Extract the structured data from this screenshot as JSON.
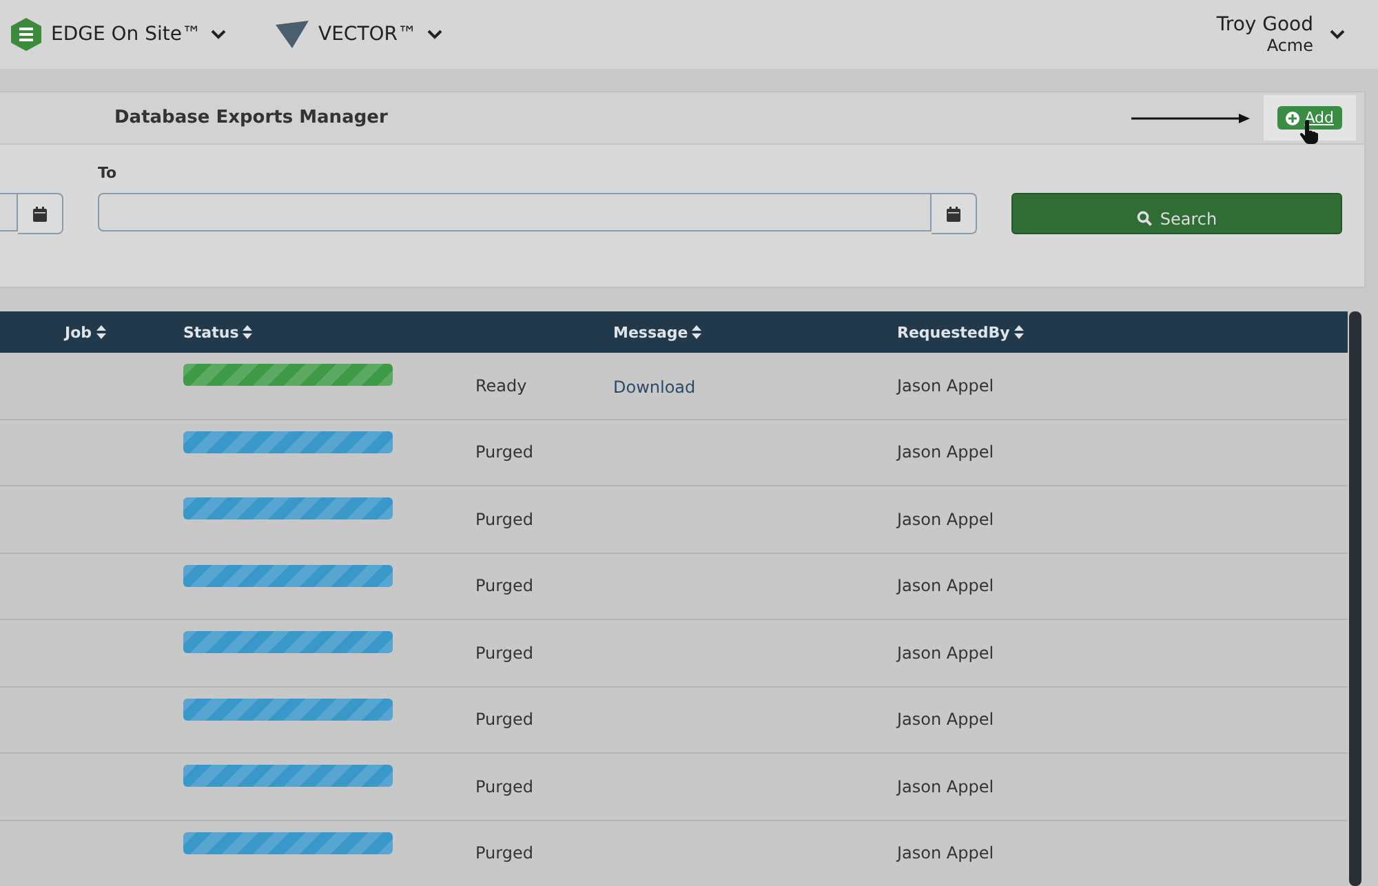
{
  "top_bar": {
    "apps": [
      {
        "label": "EDGE On Site™",
        "kind": "edge"
      },
      {
        "label": "VECTOR™",
        "kind": "vector"
      }
    ],
    "user": {
      "name": "Troy Good",
      "company": "Acme"
    }
  },
  "panel": {
    "title": "Database Exports Manager",
    "add_button": "Add",
    "to_label": "To",
    "search_button": "Search"
  },
  "table": {
    "columns": [
      {
        "label": "Job",
        "kind": "job"
      },
      {
        "label": "Status",
        "kind": "bar"
      },
      {
        "kind": "status"
      },
      {
        "label": "Message",
        "kind": "message"
      },
      {
        "label": "RequestedBy",
        "kind": "requested"
      }
    ],
    "rows": [
      {
        "status": "Ready",
        "color": "#3f9a47",
        "message": "Download",
        "requested_by": "Jason Appel"
      },
      {
        "status": "Purged",
        "color": "#3a97c9",
        "requested_by": "Jason Appel"
      },
      {
        "status": "Purged",
        "color": "#3a97c9",
        "requested_by": "Jason Appel"
      },
      {
        "status": "Purged",
        "color": "#3a97c9",
        "requested_by": "Jason Appel"
      },
      {
        "status": "Purged",
        "color": "#3a97c9",
        "requested_by": "Jason Appel"
      },
      {
        "status": "Purged",
        "color": "#3a97c9",
        "requested_by": "Jason Appel"
      },
      {
        "status": "Purged",
        "color": "#3a97c9",
        "requested_by": "Jason Appel"
      },
      {
        "status": "Purged",
        "color": "#3a97c9",
        "requested_by": "Jason Appel"
      }
    ]
  }
}
